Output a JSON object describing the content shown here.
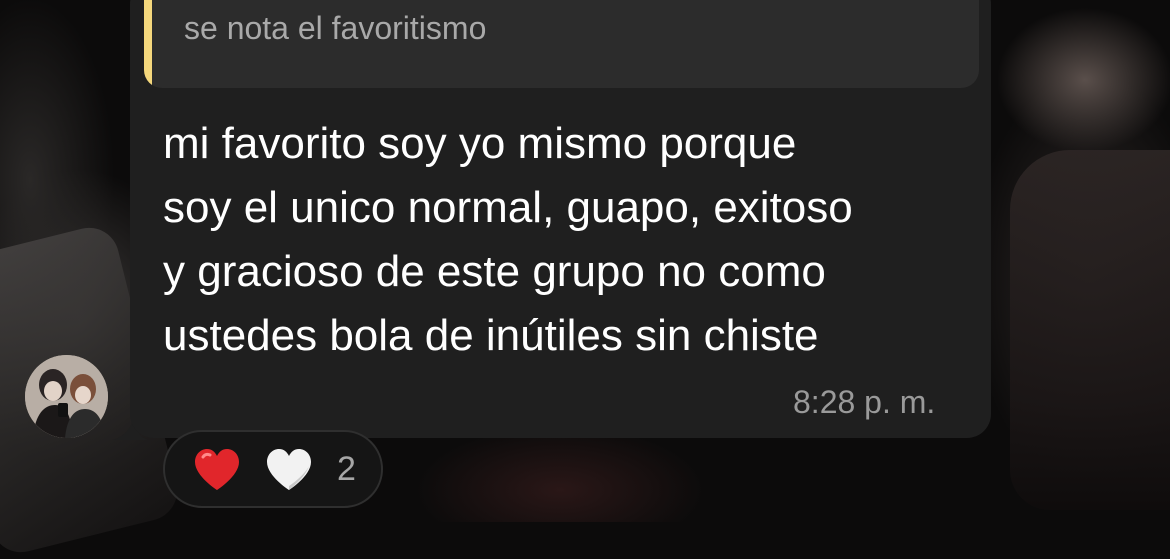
{
  "message": {
    "quoted_text": "se nota el favoritismo",
    "lines": [
      "mi favorito soy yo mismo porque",
      "soy el unico normal, guapo, exitoso",
      "y gracioso de este grupo no como",
      "ustedes bola de inútiles sin chiste"
    ],
    "timestamp": "8:28 p. m."
  },
  "reactions": {
    "icons": [
      "red-heart-icon",
      "white-heart-icon"
    ],
    "count": "2"
  },
  "colors": {
    "bubble": "#1f1f1f",
    "quote_bg": "#2c2c2c",
    "quote_bar": "#f4d77c",
    "text": "#ffffff",
    "meta_text": "#9a9a9a"
  }
}
